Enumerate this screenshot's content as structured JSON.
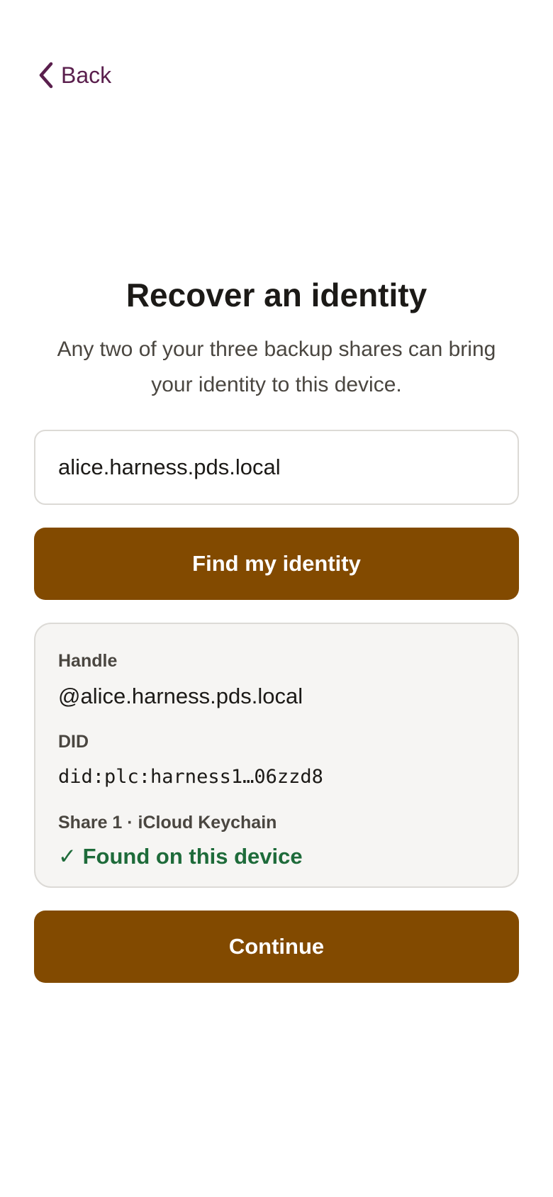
{
  "nav": {
    "back_label": "Back"
  },
  "header": {
    "title": "Recover an identity",
    "subtitle": "Any two of your three backup shares can bring your identity to this device."
  },
  "form": {
    "handle_value": "alice.harness.pds.local",
    "find_button_label": "Find my identity"
  },
  "result": {
    "handle_label": "Handle",
    "handle_value": "@alice.harness.pds.local",
    "did_label": "DID",
    "did_value": "did:plc:harness1…06zzd8",
    "share_label": "Share 1 · iCloud Keychain",
    "share_status": "✓ Found on this device"
  },
  "actions": {
    "continue_label": "Continue"
  },
  "colors": {
    "accent": "#824a00",
    "back_link": "#5a1f4d",
    "success": "#1e6b3a",
    "card_bg": "#f6f5f3"
  }
}
